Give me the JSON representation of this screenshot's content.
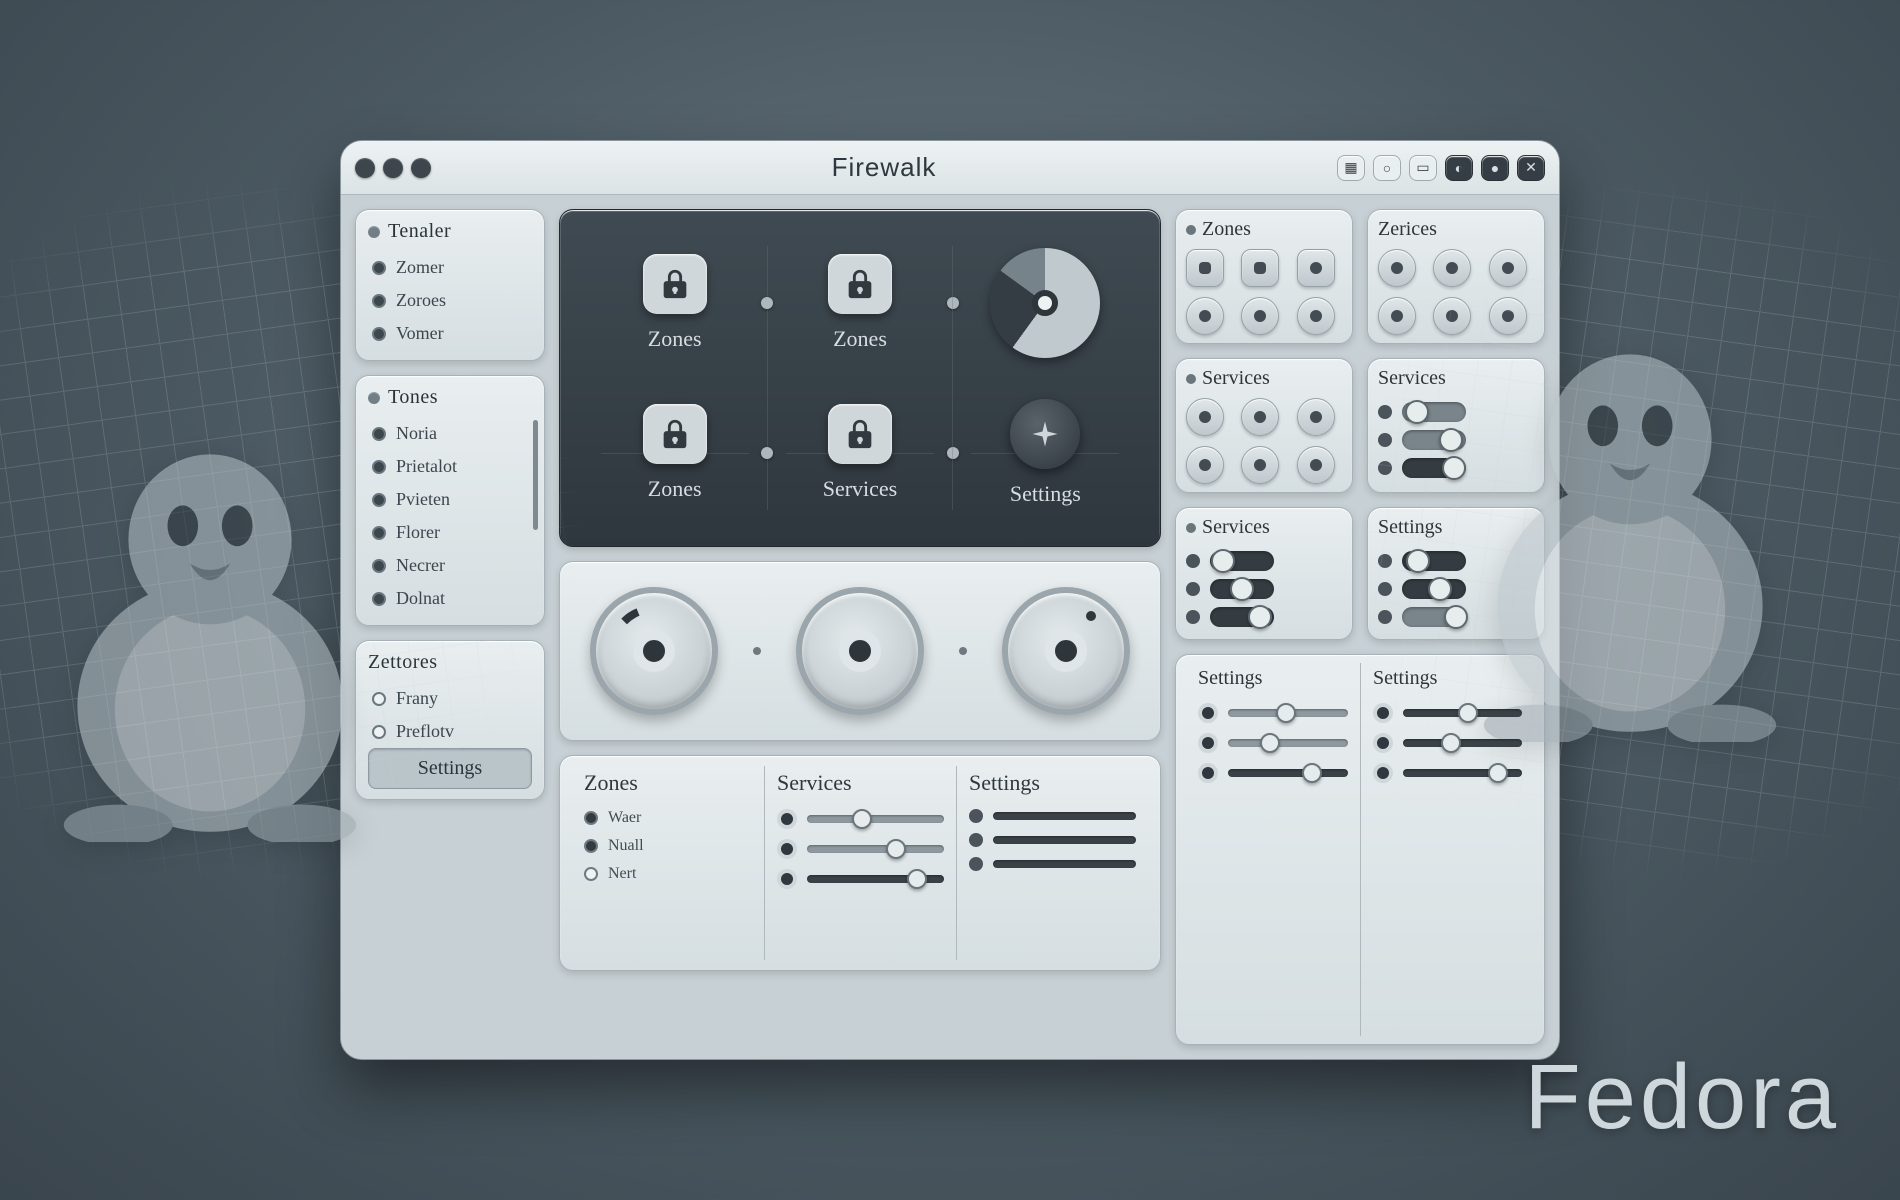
{
  "background": {
    "wordmark": "Fedora"
  },
  "window": {
    "title": "Firewalk",
    "controls": [
      "grid",
      "pin",
      "min",
      "dark-a",
      "dark-b",
      "close"
    ]
  },
  "sidebar": {
    "panel1": {
      "header": "Tenaler",
      "items": [
        "Zomer",
        "Zoroes",
        "Vomer"
      ]
    },
    "panel2": {
      "header": "Tones",
      "items": [
        "Noria",
        "Prietalot",
        "Pvieten",
        "Florer",
        "Necrer",
        "Dolnat"
      ]
    },
    "panel3": {
      "header": "Zettores",
      "items": [
        "Frany",
        "Preflotv"
      ],
      "tab": "Settings"
    }
  },
  "center": {
    "zone_grid": [
      "Zones",
      "Zones",
      "",
      "Zones",
      "Services",
      "Settings"
    ],
    "bottom_panel": {
      "columns": [
        {
          "heading": "Zones",
          "rows": [
            "Waer",
            "Nuall",
            "Nert"
          ]
        },
        {
          "heading": "Services",
          "rows": [
            "",
            "",
            ""
          ]
        },
        {
          "heading": "Settings",
          "rows": [
            "",
            "",
            ""
          ]
        }
      ]
    }
  },
  "right": {
    "p1": "Zones",
    "p2": "Zerices",
    "p3": "Services",
    "p4": "Services",
    "p5": "Services",
    "p6": "Settings",
    "bottom": {
      "c1": "Settings",
      "c2": "Settings"
    }
  }
}
